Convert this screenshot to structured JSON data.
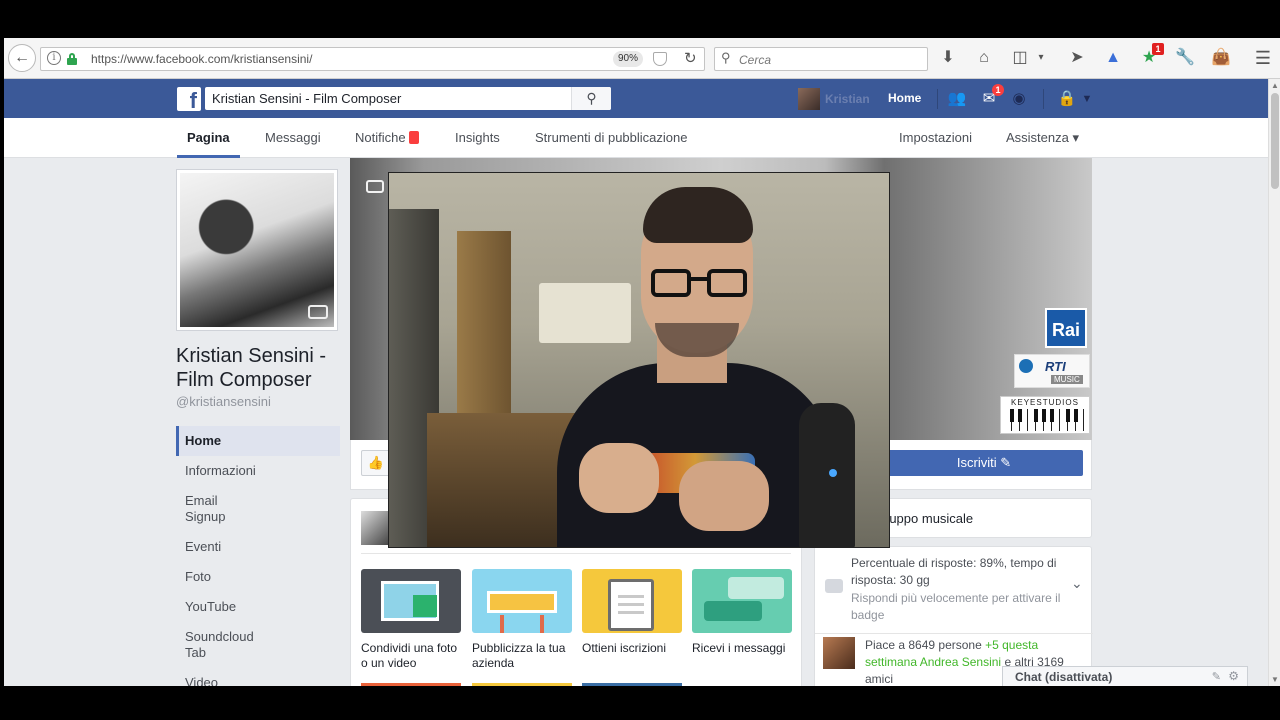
{
  "browser": {
    "url": "https://www.facebook.com/kristiansensini/",
    "zoom": "90%",
    "search_placeholder": "Cerca",
    "toolbar_badge": "1"
  },
  "fb_header": {
    "search_value": "Kristian Sensini - Film Composer",
    "user_name": "Kristian",
    "home_label": "Home",
    "messages_badge": "1"
  },
  "page_tabs": {
    "left": [
      "Pagina",
      "Messaggi",
      "Notifiche",
      "Insights",
      "Strumenti di pubblicazione"
    ],
    "right": [
      "Impostazioni",
      "Assistenza ▾"
    ]
  },
  "page": {
    "name": "Kristian Sensini - Film Composer",
    "handle": "@kristiansensini"
  },
  "left_nav": [
    "Home",
    "Informazioni",
    "Email Signup",
    "Eventi",
    "Foto",
    "YouTube",
    "Soundcloud Tab",
    "Video"
  ],
  "cover": {
    "logos": {
      "rai": "Rai",
      "rti": "RTI",
      "rti_sub": "MUSIC",
      "keystudios": "KEYESTUDIOS"
    }
  },
  "actions": {
    "subscribe_label": "Iscriviti ✎"
  },
  "composer": {
    "tiles": [
      {
        "label": "Condividi una foto o un video",
        "color": "#4b4f56"
      },
      {
        "label": "Pubblicizza la tua azienda",
        "color": "#8ad6ef"
      },
      {
        "label": "Ottieni iscrizioni",
        "color": "#f5c83c"
      },
      {
        "label": "Ricevi i messaggi",
        "color": "#66cdb0"
      }
    ]
  },
  "right_col": {
    "category": "ruppo musicale",
    "response_rate": "Percentuale di risposte: 89%, tempo di risposta: 30 gg",
    "response_hint": "Rispondi più velocemente per attivare il badge",
    "likes_text": "Piace a 8649 persone",
    "likes_week": "+5 questa settimana",
    "friend_name": "Andrea Sensini",
    "friends_rest": "e altri 3169 amici"
  },
  "chat": {
    "label": "Chat (disattivata)"
  },
  "colors": {
    "fb_blue": "#3b5998",
    "button_blue": "#4267b2",
    "badge_red": "#fa3e3e",
    "green": "#42b72a"
  }
}
